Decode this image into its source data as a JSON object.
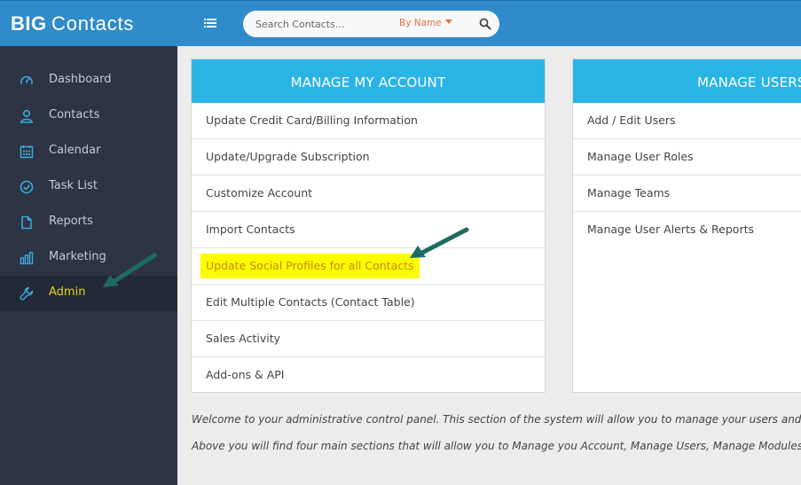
{
  "header": {
    "logo_text": "BIGContacts",
    "search": {
      "placeholder": "Search Contacts...",
      "filter_label": "By Name"
    }
  },
  "sidebar": {
    "items": [
      {
        "label": "Dashboard",
        "icon": "dashboard-icon"
      },
      {
        "label": "Contacts",
        "icon": "user-icon"
      },
      {
        "label": "Calendar",
        "icon": "calendar-icon"
      },
      {
        "label": "Task List",
        "icon": "check-circle-icon"
      },
      {
        "label": "Reports",
        "icon": "document-icon"
      },
      {
        "label": "Marketing",
        "icon": "bar-chart-icon"
      },
      {
        "label": "Admin",
        "icon": "wrench-icon",
        "active": true
      }
    ]
  },
  "panels": {
    "account": {
      "title": "MANAGE MY ACCOUNT",
      "items": [
        "Update Credit Card/Billing Information",
        "Update/Upgrade Subscription",
        "Customize Account",
        "Import Contacts",
        "Update Social Profiles for all Contacts",
        "Edit Multiple Contacts (Contact Table)",
        "Sales Activity",
        "Add-ons & API"
      ]
    },
    "users": {
      "title": "MANAGE USERS",
      "items": [
        "Add / Edit Users",
        "Manage User Roles",
        "Manage Teams",
        "Manage User Alerts & Reports"
      ]
    }
  },
  "welcome": {
    "line1": "Welcome to your administrative control panel. This section of the system will allow you to manage your users and cust",
    "line2": "Above you will find four main sections that will allow you to Manage you Account, Manage Users, Manage Modules or M"
  },
  "colors": {
    "topbar": "#2f8bca",
    "sidebar": "#2d3545",
    "panel_header": "#2ab4e6",
    "highlight": "#fdfb00",
    "active_label": "#e4d21b",
    "annotation_arrow": "#1f6b62"
  }
}
